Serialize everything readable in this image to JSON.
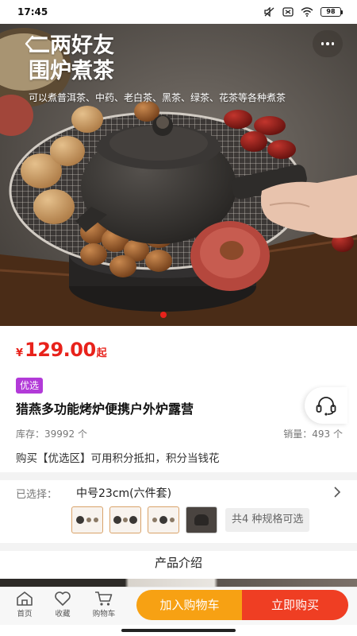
{
  "status_bar": {
    "time": "17:45",
    "battery": "98"
  },
  "hero": {
    "title_line1": "二两好友",
    "title_line2": "围炉煮茶",
    "subtitle": "可以煮普洱茶、中药、老白茶、黑茶、绿茶、花茶等各种煮茶",
    "dot_count": 1
  },
  "price": {
    "currency": "¥",
    "value": "129.00",
    "suffix": "起",
    "color": "#e8221b"
  },
  "product": {
    "tag": "优选",
    "tag_color": "#b23ad8",
    "title": "猎燕多功能烤炉便携户外炉露营",
    "stock": "库存：39992 个",
    "sold": "销量：493 个",
    "points_note": "购买【优选区】可用积分抵扣，积分当钱花"
  },
  "spec": {
    "label": "已选择：",
    "value": "中号23cm(六件套)",
    "count_text": "共4 种规格可选"
  },
  "intro": {
    "title": "产品介绍"
  },
  "bottom_nav": {
    "home": "首页",
    "favorite": "收藏",
    "cart": "购物车",
    "add_to_cart": "加入购物车",
    "buy_now": "立即购买",
    "add_to_cart_color": "#f7a113",
    "buy_now_color": "#ef3e23"
  },
  "icons": [
    "back-arrow-icon",
    "more-icon",
    "customer-service-icon",
    "chevron-right-icon",
    "home-icon",
    "heart-icon",
    "cart-icon"
  ]
}
